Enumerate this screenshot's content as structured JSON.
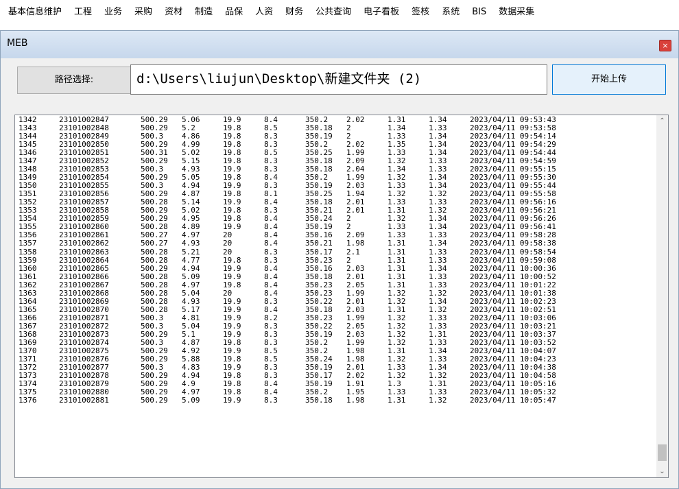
{
  "menu": [
    "基本信息维护",
    "工程",
    "业务",
    "采购",
    "资材",
    "制造",
    "品保",
    "人资",
    "财务",
    "公共查询",
    "电子看板",
    "签核",
    "系统",
    "BIS",
    "数据采集"
  ],
  "window": {
    "title": "MEB",
    "close_glyph": "×",
    "path_button_label": "路径选择:",
    "path_value": "d:\\Users\\liujun\\Desktop\\新建文件夹 (2)",
    "upload_button_label": "开始上传"
  },
  "scrollbar": {
    "up_glyph": "⌃",
    "down_glyph": "⌄"
  },
  "rows": [
    [
      "1342",
      "23101002847",
      "500.29",
      "5.06",
      "19.9",
      "8.4",
      "350.2",
      "2.02",
      "1.31",
      "1.34",
      "2023/04/11 09:53:43"
    ],
    [
      "1343",
      "23101002848",
      "500.29",
      "5.2",
      "19.8",
      "8.5",
      "350.18",
      "2",
      "1.34",
      "1.33",
      "2023/04/11 09:53:58"
    ],
    [
      "1344",
      "23101002849",
      "500.3",
      "4.86",
      "19.8",
      "8.3",
      "350.19",
      "2",
      "1.33",
      "1.34",
      "2023/04/11 09:54:14"
    ],
    [
      "1345",
      "23101002850",
      "500.29",
      "4.99",
      "19.8",
      "8.3",
      "350.2",
      "2.02",
      "1.35",
      "1.34",
      "2023/04/11 09:54:29"
    ],
    [
      "1346",
      "23101002851",
      "500.31",
      "5.02",
      "19.8",
      "8.5",
      "350.25",
      "1.99",
      "1.33",
      "1.34",
      "2023/04/11 09:54:44"
    ],
    [
      "1347",
      "23101002852",
      "500.29",
      "5.15",
      "19.8",
      "8.3",
      "350.18",
      "2.09",
      "1.32",
      "1.33",
      "2023/04/11 09:54:59"
    ],
    [
      "1348",
      "23101002853",
      "500.3",
      "4.93",
      "19.9",
      "8.3",
      "350.18",
      "2.04",
      "1.34",
      "1.33",
      "2023/04/11 09:55:15"
    ],
    [
      "1349",
      "23101002854",
      "500.29",
      "5.05",
      "19.8",
      "8.4",
      "350.2",
      "1.99",
      "1.32",
      "1.34",
      "2023/04/11 09:55:30"
    ],
    [
      "1350",
      "23101002855",
      "500.3",
      "4.94",
      "19.9",
      "8.3",
      "350.19",
      "2.03",
      "1.33",
      "1.34",
      "2023/04/11 09:55:44"
    ],
    [
      "1351",
      "23101002856",
      "500.29",
      "4.87",
      "19.8",
      "8.1",
      "350.25",
      "1.94",
      "1.32",
      "1.32",
      "2023/04/11 09:55:58"
    ],
    [
      "1352",
      "23101002857",
      "500.28",
      "5.14",
      "19.9",
      "8.4",
      "350.18",
      "2.01",
      "1.33",
      "1.33",
      "2023/04/11 09:56:16"
    ],
    [
      "1353",
      "23101002858",
      "500.29",
      "5.02",
      "19.8",
      "8.3",
      "350.21",
      "2.01",
      "1.31",
      "1.32",
      "2023/04/11 09:56:21"
    ],
    [
      "1354",
      "23101002859",
      "500.29",
      "4.95",
      "19.8",
      "8.4",
      "350.24",
      "2",
      "1.32",
      "1.34",
      "2023/04/11 09:56:26"
    ],
    [
      "1355",
      "23101002860",
      "500.28",
      "4.89",
      "19.9",
      "8.4",
      "350.19",
      "2",
      "1.33",
      "1.34",
      "2023/04/11 09:56:41"
    ],
    [
      "1356",
      "23101002861",
      "500.27",
      "4.97",
      "20",
      "8.4",
      "350.16",
      "2.09",
      "1.33",
      "1.33",
      "2023/04/11 09:58:28"
    ],
    [
      "1357",
      "23101002862",
      "500.27",
      "4.93",
      "20",
      "8.4",
      "350.21",
      "1.98",
      "1.31",
      "1.34",
      "2023/04/11 09:58:38"
    ],
    [
      "1358",
      "23101002863",
      "500.28",
      "5.21",
      "20",
      "8.3",
      "350.17",
      "2.1",
      "1.31",
      "1.33",
      "2023/04/11 09:58:54"
    ],
    [
      "1359",
      "23101002864",
      "500.28",
      "4.77",
      "19.8",
      "8.3",
      "350.23",
      "2",
      "1.31",
      "1.33",
      "2023/04/11 09:59:08"
    ],
    [
      "1360",
      "23101002865",
      "500.29",
      "4.94",
      "19.9",
      "8.4",
      "350.16",
      "2.03",
      "1.31",
      "1.34",
      "2023/04/11 10:00:36"
    ],
    [
      "1361",
      "23101002866",
      "500.28",
      "5.09",
      "19.9",
      "8.4",
      "350.18",
      "2.01",
      "1.31",
      "1.33",
      "2023/04/11 10:00:52"
    ],
    [
      "1362",
      "23101002867",
      "500.28",
      "4.97",
      "19.8",
      "8.4",
      "350.23",
      "2.05",
      "1.31",
      "1.33",
      "2023/04/11 10:01:22"
    ],
    [
      "1363",
      "23101002868",
      "500.28",
      "5.04",
      "20",
      "8.4",
      "350.23",
      "1.99",
      "1.32",
      "1.32",
      "2023/04/11 10:01:38"
    ],
    [
      "1364",
      "23101002869",
      "500.28",
      "4.93",
      "19.9",
      "8.3",
      "350.22",
      "2.01",
      "1.32",
      "1.34",
      "2023/04/11 10:02:23"
    ],
    [
      "1365",
      "23101002870",
      "500.28",
      "5.17",
      "19.9",
      "8.4",
      "350.18",
      "2.03",
      "1.31",
      "1.32",
      "2023/04/11 10:02:51"
    ],
    [
      "1366",
      "23101002871",
      "500.3",
      "4.81",
      "19.9",
      "8.2",
      "350.23",
      "1.99",
      "1.32",
      "1.33",
      "2023/04/11 10:03:06"
    ],
    [
      "1367",
      "23101002872",
      "500.3",
      "5.04",
      "19.9",
      "8.3",
      "350.22",
      "2.05",
      "1.32",
      "1.33",
      "2023/04/11 10:03:21"
    ],
    [
      "1368",
      "23101002873",
      "500.29",
      "5.1",
      "19.9",
      "8.3",
      "350.19",
      "2.03",
      "1.32",
      "1.31",
      "2023/04/11 10:03:37"
    ],
    [
      "1369",
      "23101002874",
      "500.3",
      "4.87",
      "19.8",
      "8.3",
      "350.2",
      "1.99",
      "1.32",
      "1.33",
      "2023/04/11 10:03:52"
    ],
    [
      "1370",
      "23101002875",
      "500.29",
      "4.92",
      "19.9",
      "8.5",
      "350.2",
      "1.98",
      "1.31",
      "1.34",
      "2023/04/11 10:04:07"
    ],
    [
      "1371",
      "23101002876",
      "500.29",
      "5.88",
      "19.8",
      "8.5",
      "350.24",
      "1.98",
      "1.32",
      "1.33",
      "2023/04/11 10:04:23"
    ],
    [
      "1372",
      "23101002877",
      "500.3",
      "4.83",
      "19.9",
      "8.3",
      "350.19",
      "2.01",
      "1.33",
      "1.34",
      "2023/04/11 10:04:38"
    ],
    [
      "1373",
      "23101002878",
      "500.29",
      "4.94",
      "19.8",
      "8.3",
      "350.17",
      "2.02",
      "1.32",
      "1.32",
      "2023/04/11 10:04:58"
    ],
    [
      "1374",
      "23101002879",
      "500.29",
      "4.9",
      "19.8",
      "8.4",
      "350.19",
      "1.91",
      "1.3",
      "1.31",
      "2023/04/11 10:05:16"
    ],
    [
      "1375",
      "23101002880",
      "500.29",
      "4.97",
      "19.8",
      "8.4",
      "350.2",
      "1.95",
      "1.33",
      "1.33",
      "2023/04/11 10:05:32"
    ],
    [
      "1376",
      "23101002881",
      "500.29",
      "5.09",
      "19.9",
      "8.3",
      "350.18",
      "1.98",
      "1.31",
      "1.32",
      "2023/04/11 10:05:47"
    ]
  ]
}
